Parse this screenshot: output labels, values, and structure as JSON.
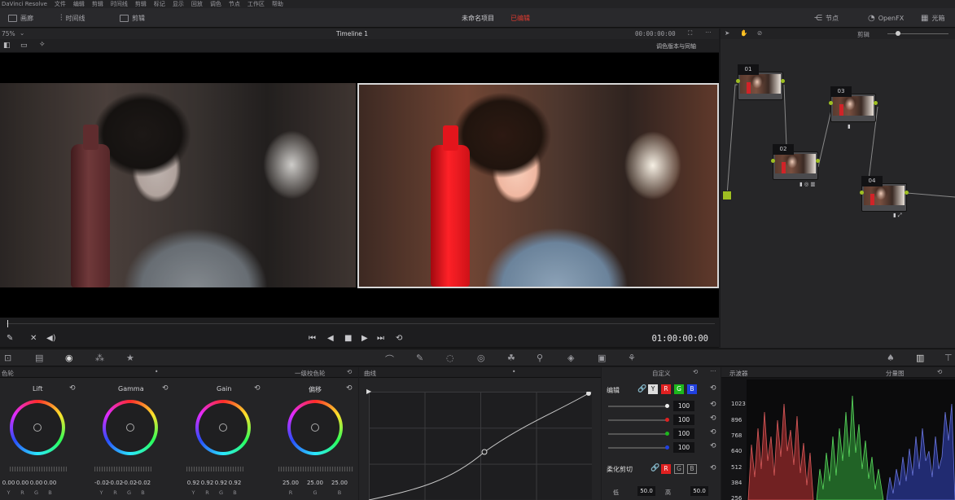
{
  "menubar": {
    "items": [
      "DaVinci Resolve",
      "文件",
      "编辑",
      "剪辑",
      "时间线",
      "剪辑",
      "标记",
      "显示",
      "回放",
      "调色",
      "节点",
      "工作区",
      "帮助"
    ]
  },
  "toolbar": {
    "media": "画廊",
    "timeline": "时间线",
    "clips": "剪辑",
    "project_title": "未命名项目",
    "project_status": "已编辑",
    "nodes": "节点",
    "openfx": "OpenFX",
    "lightbox": "光箱"
  },
  "viewer": {
    "zoom": "75%",
    "timeline_name": "Timeline 1",
    "timecode_top": "00:00:00:00",
    "mode_select": "调色版本与同轴",
    "timecode": "01:00:00:00"
  },
  "node_editor": {
    "mode": "剪辑",
    "nodes": [
      {
        "num": "01"
      },
      {
        "num": "03"
      },
      {
        "num": "02"
      },
      {
        "num": "04"
      }
    ]
  },
  "color_wheels": {
    "panel_title": "色轮",
    "mode": "一级校色轮",
    "wheels": [
      {
        "name": "Lift",
        "values": [
          "0.00",
          "0.00",
          "0.00",
          "0.00"
        ],
        "labels": [
          "Y",
          "R",
          "G",
          "B"
        ]
      },
      {
        "name": "Gamma",
        "values": [
          "-0.02",
          "-0.02",
          "-0.02",
          "-0.02"
        ],
        "labels": [
          "Y",
          "R",
          "G",
          "B"
        ]
      },
      {
        "name": "Gain",
        "values": [
          "0.92",
          "0.92",
          "0.92",
          "0.92"
        ],
        "labels": [
          "Y",
          "R",
          "G",
          "B"
        ]
      },
      {
        "name": "偏移",
        "values": [
          "25.00",
          "25.00",
          "25.00"
        ],
        "labels": [
          "R",
          "G",
          "B"
        ]
      }
    ]
  },
  "curves": {
    "panel_title": "曲线",
    "custom": "自定义"
  },
  "curve_edit": {
    "edit_label": "编辑",
    "channels": [
      "Y",
      "R",
      "G",
      "B"
    ],
    "values": [
      "100",
      "100",
      "100",
      "100"
    ],
    "soft_clip_label": "柔化剪切",
    "low_label": "低",
    "low": "50.0",
    "high_label": "高",
    "high": "50.0"
  },
  "scopes": {
    "panel_title": "示波器",
    "mode": "分量图",
    "scale": [
      "1023",
      "896",
      "768",
      "640",
      "512",
      "384",
      "256"
    ]
  }
}
